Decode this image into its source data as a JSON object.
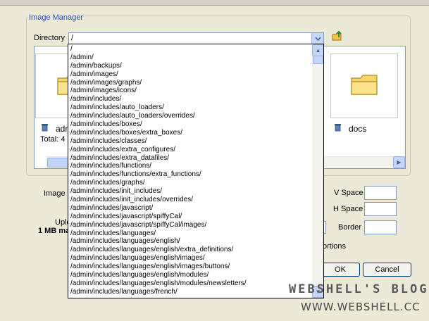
{
  "fieldset": {
    "legend": "Image Manager"
  },
  "directory": {
    "label": "Directory",
    "value": "/",
    "options": [
      "/",
      "/admin/",
      "/admin/backups/",
      "/admin/images/",
      "/admin/images/graphs/",
      "/admin/images/icons/",
      "/admin/includes/",
      "/admin/includes/auto_loaders/",
      "/admin/includes/auto_loaders/overrides/",
      "/admin/includes/boxes/",
      "/admin/includes/boxes/extra_boxes/",
      "/admin/includes/classes/",
      "/admin/includes/extra_configures/",
      "/admin/includes/extra_datafiles/",
      "/admin/includes/functions/",
      "/admin/includes/functions/extra_functions/",
      "/admin/includes/graphs/",
      "/admin/includes/init_includes/",
      "/admin/includes/init_includes/overrides/",
      "/admin/includes/javascript/",
      "/admin/includes/javascript/spiffyCal/",
      "/admin/includes/javascript/spiffyCal/images/",
      "/admin/includes/languages/",
      "/admin/includes/languages/english/",
      "/admin/includes/languages/english/extra_definitions/",
      "/admin/includes/languages/english/images/",
      "/admin/includes/languages/english/images/buttons/",
      "/admin/includes/languages/english/modules/",
      "/admin/includes/languages/english/modules/newsletters/",
      "/admin/includes/languages/french/"
    ]
  },
  "thumbnails": [
    {
      "caption": "adm"
    },
    {
      "caption": "docs"
    }
  ],
  "total_label": "Total: 4",
  "form": {
    "image_label": "Image f",
    "upload_label": "Uplo",
    "max_label": "1 MB ma",
    "vspace_label": "V Space",
    "hspace_label": "H Space",
    "border_label": "Border",
    "proportions_label": "ortions",
    "ok_label": "OK",
    "cancel_label": "Cancel"
  },
  "watermark": {
    "title": "WEBSHELL'S BLOG",
    "url": "WWW.WEBSHELL.CC"
  }
}
